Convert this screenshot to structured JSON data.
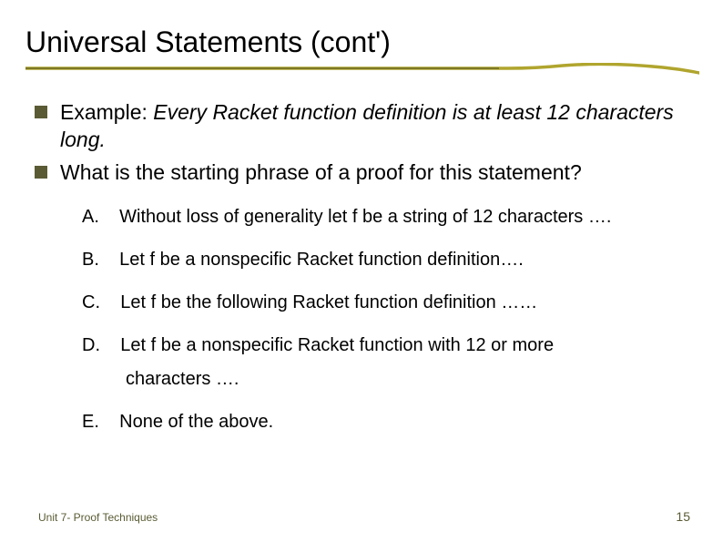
{
  "title": "Universal Statements (cont')",
  "bullets": [
    {
      "prefix": "Example: ",
      "italic": "Every Racket function definition is at least 12 characters long."
    },
    {
      "text": "What is the starting phrase of a proof for this statement?"
    }
  ],
  "options": [
    {
      "label": "A.",
      "text": "Without loss of generality let f be a string of 12 characters …."
    },
    {
      "label": "B.",
      "text": "Let f be a nonspecific Racket function definition…."
    },
    {
      "label": "C.",
      "text": " Let f be the following Racket function definition ……"
    },
    {
      "label": "D.",
      "text": " Let f be a nonspecific Racket function with 12 or more",
      "cont": "characters …."
    },
    {
      "label": "E.",
      "text": "None of the above."
    }
  ],
  "footer": "Unit 7- Proof Techniques",
  "page": "15",
  "colors": {
    "olive": "#a79b2a",
    "olive_dark": "#6a6830"
  }
}
